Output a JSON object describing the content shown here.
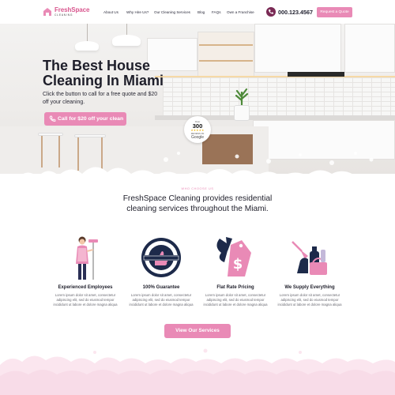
{
  "header": {
    "logo_main": "FreshSpace",
    "logo_sub": "CLEANING",
    "nav": [
      "About Us",
      "Why Hire Us?",
      "Our Cleaning Services",
      "Blog",
      "FAQs",
      "Own a Franchise"
    ],
    "phone": "000.123.4567",
    "quote_button": "Request a Quote"
  },
  "hero": {
    "title": "The Best House Cleaning In Miami",
    "subtitle": "Click the button to call for a free quote and $20 off your cleaning.",
    "cta": "Call for $20 off your clean",
    "badge": {
      "top": "Over",
      "number": "300",
      "stars": "★★★★★",
      "sub": "REVIEWS ON",
      "brand": "Google"
    }
  },
  "about": {
    "eyebrow": "WHO CHOOSE US",
    "title": "FreshSpace Cleaning provides residential cleaning services throughout the Miami."
  },
  "features": [
    {
      "title": "Experienced Employees",
      "text": "Lorem ipsum dolor sit amet, consectetur adipiscing elit, sed do eiusmod tempor incididunt ut labore et dolore magna aliqua",
      "icon": "cleaner-person-icon"
    },
    {
      "title": "100% Guarantee",
      "text": "Lorem ipsum dolor sit amet, consectetur adipiscing elit, sed do eiusmod tempor incididunt ut labore et dolore magna aliqua",
      "icon": "guarantee-seal-icon",
      "seal_text": "100% GUARANTEE SATISFACTION"
    },
    {
      "title": "Flat Rate Pricing",
      "text": "Lorem ipsum dolor sit amet, consectetur adipiscing elit, sed do eiusmod tempor incididunt ut labore et dolore magna aliqua",
      "icon": "price-tag-icon",
      "tag_symbol": "$"
    },
    {
      "title": "We Supply Everything",
      "text": "Lorem ipsum dolor sit amet, consectetur adipiscing elit, sed do eiusmod tempor incididunt ut labore et dolore magna aliqua",
      "icon": "cleaning-supplies-icon"
    }
  ],
  "services_button": "View Our Services",
  "colors": {
    "accent": "#e98ab6",
    "brand": "#d9578f",
    "dark": "#1e1e2a",
    "navy": "#1d2a4a"
  }
}
